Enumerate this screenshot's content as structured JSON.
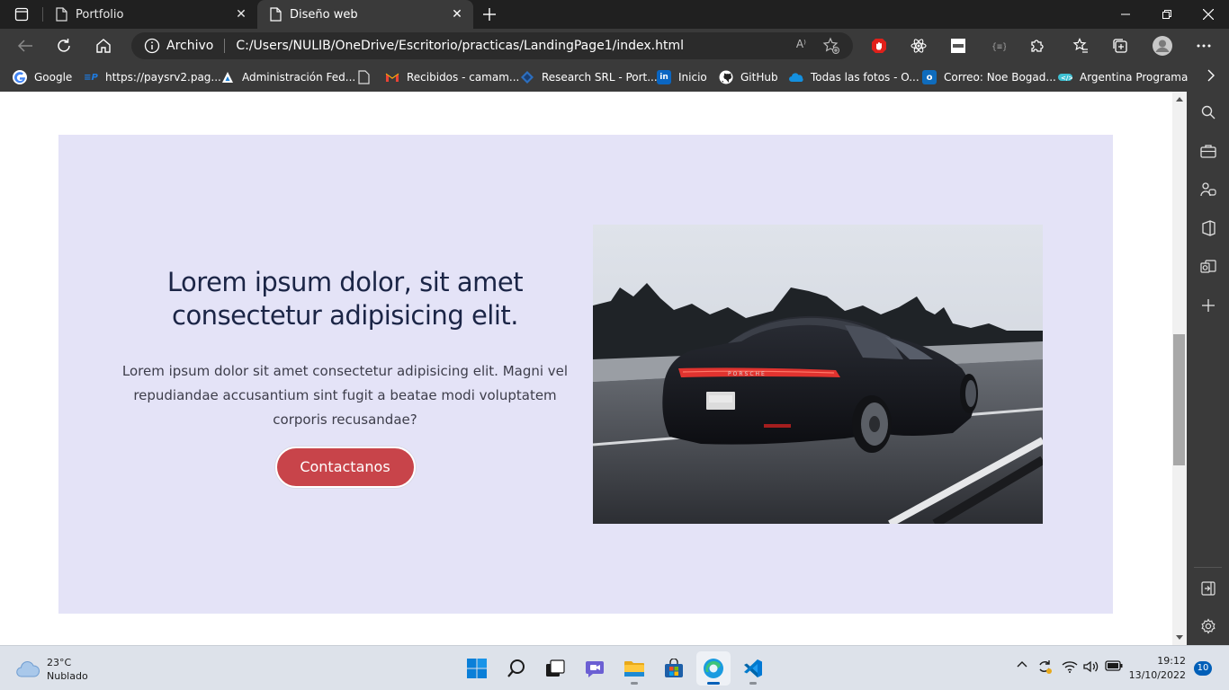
{
  "tabs": [
    {
      "title": "Portfolio",
      "active": false
    },
    {
      "title": "Diseño web",
      "active": true
    }
  ],
  "toolbar": {
    "site_info_label": "Archivo",
    "url": "C:/Users/NULIB/OneDrive/Escritorio/practicas/LandingPage1/index.html",
    "read_aloud_label": "A⁾"
  },
  "bookmarks": [
    {
      "label": "Google",
      "icon": "google-icon",
      "color": "#ffffff"
    },
    {
      "label": "https://paysrv2.pag...",
      "icon": "pago-icon",
      "color": "#1e7be0"
    },
    {
      "label": "Administración Fed...",
      "icon": "afip-icon",
      "color": "#1b7fd6"
    },
    {
      "label": "Recibidos - camam...",
      "icon": "gmail-icon",
      "color": "#ea4335"
    },
    {
      "label": "Research SRL - Port...",
      "icon": "research-icon",
      "color": "#2c6fbf"
    },
    {
      "label": "Inicio",
      "icon": "linkedin-icon",
      "color": "#0a66c2"
    },
    {
      "label": "GitHub",
      "icon": "github-icon",
      "color": "#ffffff"
    },
    {
      "label": "Todas las fotos - O...",
      "icon": "onedrive-icon",
      "color": "#1490df"
    },
    {
      "label": "Correo: Noe Bogad...",
      "icon": "outlook-icon",
      "color": "#0f6cbd"
    },
    {
      "label": "Argentina Programa",
      "icon": "argprog-icon",
      "color": "#3ec1d3"
    }
  ],
  "hero": {
    "title": "Lorem ipsum dolor, sit amet consectetur adipisicing elit.",
    "description": "Lorem ipsum dolor sit amet consectetur adipisicing elit. Magni vel repudiandae accusantium sint fugit a beatae modi voluptatem corporis recusandae?",
    "cta_label": "Contactanos",
    "image_alt": "car-photo",
    "background": "#e4e3f7",
    "cta_color": "#c8444a"
  },
  "taskbar": {
    "weather_temp": "23°C",
    "weather_desc": "Nublado",
    "time": "19:12",
    "date": "13/10/2022",
    "notifications": "10"
  }
}
